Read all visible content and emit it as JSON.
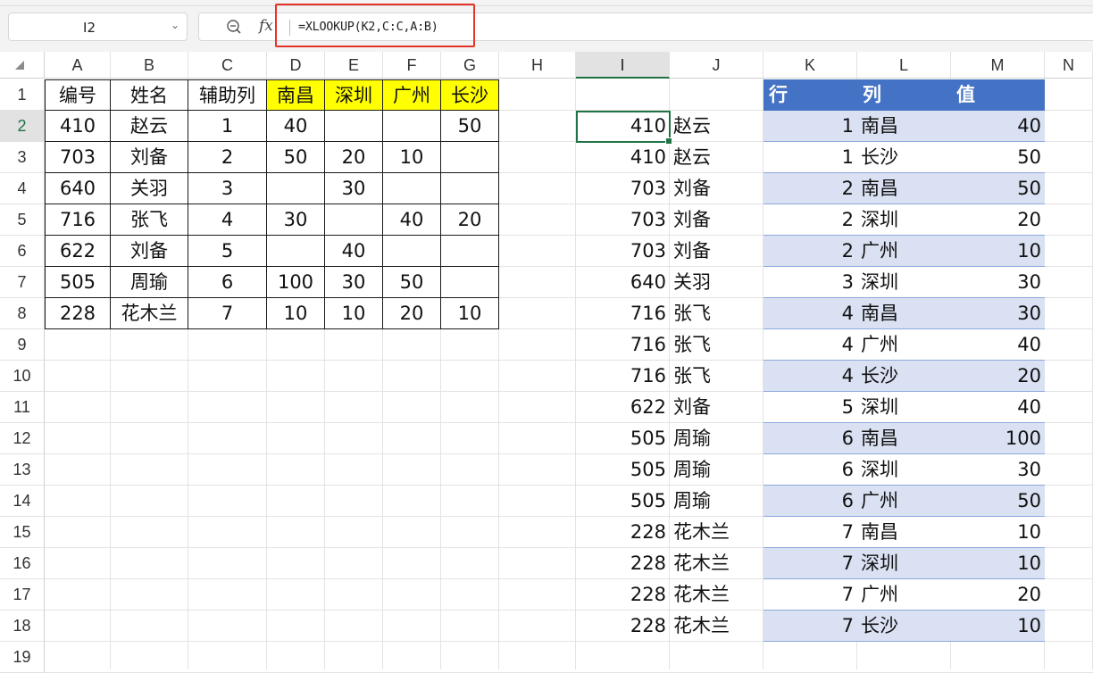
{
  "name_box": {
    "value": "I2"
  },
  "formula_bar": {
    "fx_label": "fx",
    "formula": "=XLOOKUP(K2,C:C,A:B)"
  },
  "columns": [
    "A",
    "B",
    "C",
    "D",
    "E",
    "F",
    "G",
    "H",
    "I",
    "J",
    "K",
    "L",
    "M",
    "N"
  ],
  "rows": [
    "1",
    "2",
    "3",
    "4",
    "5",
    "6",
    "7",
    "8",
    "9",
    "10",
    "11",
    "12",
    "13",
    "14",
    "15",
    "16",
    "17",
    "18",
    "19"
  ],
  "active_cell": {
    "column": "I",
    "row": "2"
  },
  "source_table": {
    "headers": [
      "编号",
      "姓名",
      "辅助列",
      "南昌",
      "深圳",
      "广州",
      "长沙"
    ],
    "rows": [
      [
        "410",
        "赵云",
        "1",
        "40",
        "",
        "",
        "50"
      ],
      [
        "703",
        "刘备",
        "2",
        "50",
        "20",
        "10",
        ""
      ],
      [
        "640",
        "关羽",
        "3",
        "",
        "30",
        "",
        ""
      ],
      [
        "716",
        "张飞",
        "4",
        "30",
        "",
        "40",
        "20"
      ],
      [
        "622",
        "刘备",
        "5",
        "",
        "40",
        "",
        ""
      ],
      [
        "505",
        "周瑜",
        "6",
        "100",
        "30",
        "50",
        ""
      ],
      [
        "228",
        "花木兰",
        "7",
        "10",
        "10",
        "20",
        "10"
      ]
    ]
  },
  "lookup_results": {
    "rows": [
      [
        "410",
        "赵云"
      ],
      [
        "410",
        "赵云"
      ],
      [
        "703",
        "刘备"
      ],
      [
        "703",
        "刘备"
      ],
      [
        "703",
        "刘备"
      ],
      [
        "640",
        "关羽"
      ],
      [
        "716",
        "张飞"
      ],
      [
        "716",
        "张飞"
      ],
      [
        "716",
        "张飞"
      ],
      [
        "622",
        "刘备"
      ],
      [
        "505",
        "周瑜"
      ],
      [
        "505",
        "周瑜"
      ],
      [
        "505",
        "周瑜"
      ],
      [
        "228",
        "花木兰"
      ],
      [
        "228",
        "花木兰"
      ],
      [
        "228",
        "花木兰"
      ],
      [
        "228",
        "花木兰"
      ]
    ]
  },
  "unpivot_table": {
    "headers": [
      "行",
      "列",
      "值"
    ],
    "rows": [
      [
        "1",
        "南昌",
        "40"
      ],
      [
        "1",
        "长沙",
        "50"
      ],
      [
        "2",
        "南昌",
        "50"
      ],
      [
        "2",
        "深圳",
        "20"
      ],
      [
        "2",
        "广州",
        "10"
      ],
      [
        "3",
        "深圳",
        "30"
      ],
      [
        "4",
        "南昌",
        "30"
      ],
      [
        "4",
        "广州",
        "40"
      ],
      [
        "4",
        "长沙",
        "20"
      ],
      [
        "5",
        "深圳",
        "40"
      ],
      [
        "6",
        "南昌",
        "100"
      ],
      [
        "6",
        "深圳",
        "30"
      ],
      [
        "6",
        "广州",
        "50"
      ],
      [
        "7",
        "南昌",
        "10"
      ],
      [
        "7",
        "深圳",
        "10"
      ],
      [
        "7",
        "广州",
        "20"
      ],
      [
        "7",
        "长沙",
        "10"
      ]
    ],
    "header_color": "#4472c4",
    "band_color": "#d9e1f2"
  },
  "colors": {
    "highlight_yellow": "#ffff00",
    "selection_green": "#217346",
    "annotation_red": "#e6332a"
  }
}
